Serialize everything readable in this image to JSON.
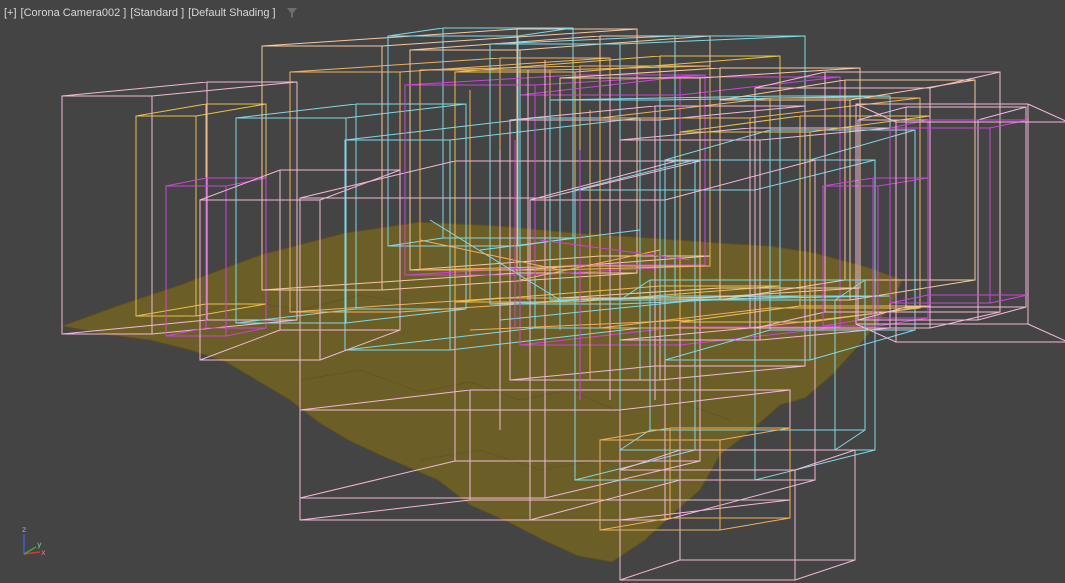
{
  "viewport": {
    "labels": {
      "plus": "[+]",
      "camera": "[Corona Camera002 ]",
      "mode": "[Standard ]",
      "shading": "[Default Shading ]"
    },
    "filter_icon": "funnel-icon",
    "background": "#444444"
  },
  "gizmo": {
    "x": "x",
    "y": "y",
    "z": "z"
  },
  "colors": {
    "terrain": "#6c5e27",
    "pink": "#f2b8d8",
    "orange": "#f0b05c",
    "yellow": "#e8c04c",
    "cyan": "#7fd9e6",
    "magenta": "#cc44d6",
    "peach": "#f5c8a0"
  }
}
